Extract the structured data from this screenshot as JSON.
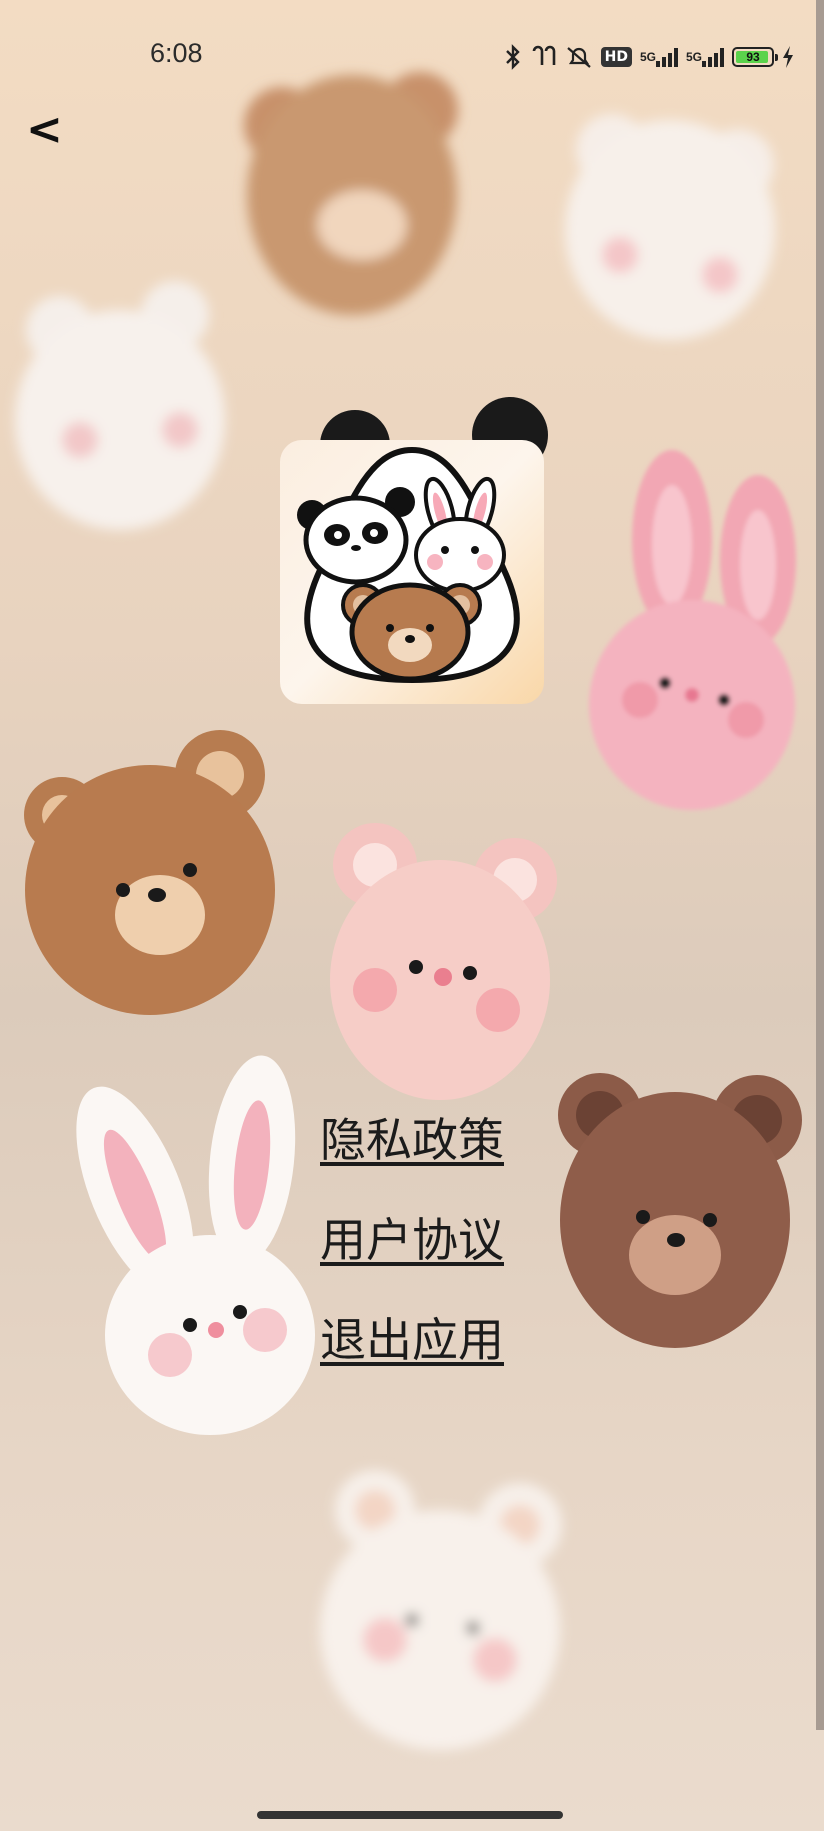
{
  "status_bar": {
    "time": "6:08",
    "icons": [
      "bluetooth-icon",
      "earbuds-icon",
      "muted-bell-icon",
      "hd-icon",
      "5g-signal-icon",
      "5g-signal-icon",
      "battery-icon",
      "charging-icon"
    ],
    "hd_label": "HD",
    "signal1_label": "5G",
    "signal2_label": "5G",
    "battery_level": "93"
  },
  "nav": {
    "back_label": "<"
  },
  "menu": {
    "items": [
      {
        "label": "隐私政策"
      },
      {
        "label": "用户协议"
      },
      {
        "label": "退出应用"
      }
    ]
  },
  "colors": {
    "background_top": "#f3dcc3",
    "background_bottom": "#eadbcd",
    "link_text": "#1b1b1b",
    "battery_fill": "#5bd34c"
  }
}
